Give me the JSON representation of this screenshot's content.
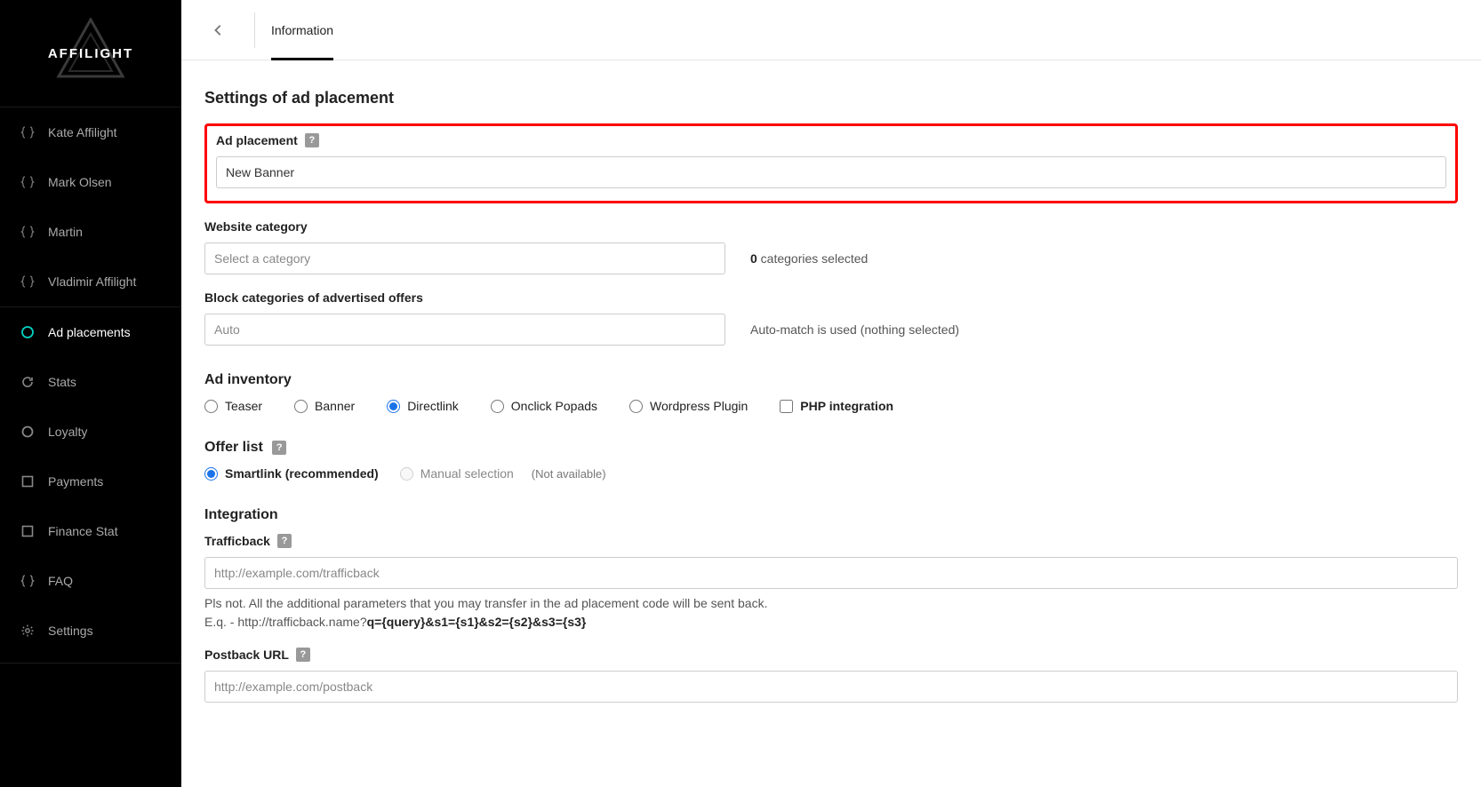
{
  "brand": {
    "name": "AFFILIGHT"
  },
  "sidebar": {
    "users": [
      {
        "label": "Kate Affilight"
      },
      {
        "label": "Mark Olsen"
      },
      {
        "label": "Martin"
      },
      {
        "label": "Vladimir Affilight"
      }
    ],
    "nav": [
      {
        "label": "Ad placements",
        "icon": "target"
      },
      {
        "label": "Stats",
        "icon": "refresh"
      },
      {
        "label": "Loyalty",
        "icon": "circle"
      },
      {
        "label": "Payments",
        "icon": "square"
      },
      {
        "label": "Finance Stat",
        "icon": "square"
      },
      {
        "label": "FAQ",
        "icon": "braces"
      },
      {
        "label": "Settings",
        "icon": "gear"
      }
    ]
  },
  "topbar": {
    "tab_information": "Information"
  },
  "settings": {
    "title": "Settings of ad placement",
    "ad_placement": {
      "label": "Ad placement",
      "value": "New Banner"
    },
    "website_category": {
      "label": "Website category",
      "placeholder": "Select a category",
      "note_count": "0",
      "note_text": " categories selected"
    },
    "block_categories": {
      "label": "Block categories of advertised offers",
      "placeholder": "Auto",
      "note": "Auto-match is used (nothing selected)"
    }
  },
  "ad_inventory": {
    "title": "Ad inventory",
    "options": {
      "teaser": "Teaser",
      "banner": "Banner",
      "directlink": "Directlink",
      "onclick": "Onclick Popads",
      "wordpress": "Wordpress Plugin",
      "php": "PHP integration"
    },
    "selected": "directlink"
  },
  "offer_list": {
    "title": "Offer list",
    "smartlink": "Smartlink (recommended)",
    "manual": "Manual selection",
    "not_available": "(Not available)",
    "selected": "smartlink"
  },
  "integration": {
    "title": "Integration",
    "trafficback": {
      "label": "Trafficback",
      "placeholder": "http://example.com/trafficback",
      "note_line1": "Pls not. All the additional parameters that you may transfer in the ad placement code will be sent back.",
      "note_line2_prefix": "E.q. - http://trafficback.name?",
      "note_line2_bold": "q={query}&s1={s1}&s2={s2}&s3={s3}"
    },
    "postback": {
      "label": "Postback URL",
      "placeholder": "http://example.com/postback"
    }
  }
}
